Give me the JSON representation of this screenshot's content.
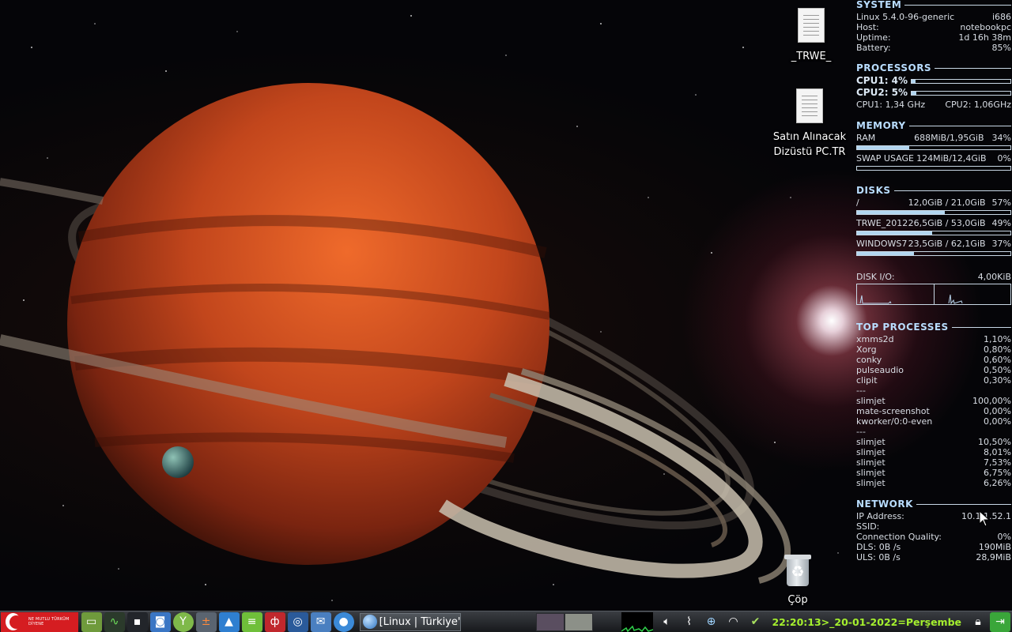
{
  "desktop": {
    "icons": [
      {
        "label": "_TRWE_"
      },
      {
        "label": "Satın Alınacak Dizüstü PC.TR"
      },
      {
        "label": "Çöp"
      }
    ]
  },
  "conky": {
    "system": {
      "header": "SYSTEM",
      "kernel": "Linux 5.4.0-96-generic",
      "arch": "i686",
      "host_label": "Host:",
      "host_value": "notebookpc",
      "uptime_label": "Uptime:",
      "uptime_value": "1d 16h 38m",
      "battery_label": "Battery:",
      "battery_value": "85%"
    },
    "processors": {
      "header": "PROCESSORS",
      "cpu1": "CPU1: 4%",
      "cpu1_level": 0.04,
      "cpu2": "CPU2: 5%",
      "cpu2_level": 0.05,
      "cpu1_freq": "CPU1: 1,34 GHz",
      "cpu2_freq": "CPU2: 1,06GHz"
    },
    "memory": {
      "header": "MEMORY",
      "ram_label": "RAM",
      "ram_value": "688MiB/1,95GiB",
      "ram_pct": "34%",
      "ram_level": 0.34,
      "swap_label": "SWAP USAGE",
      "swap_value": "124MiB/12,4GiB",
      "swap_pct": "0%",
      "swap_level": 0.0
    },
    "disks": {
      "header": "DISKS",
      "items": [
        {
          "name": "/",
          "value": "12,0GiB / 21,0GiB",
          "pct": "57%",
          "level": 0.57
        },
        {
          "name": "TRWE_2012",
          "value": "26,5GiB / 53,0GiB",
          "pct": "49%",
          "level": 0.49
        },
        {
          "name": "WINDOWS7",
          "value": "23,5GiB / 62,1GiB",
          "pct": "37%",
          "level": 0.37
        }
      ],
      "io_label": "DISK I/O:",
      "io_value": "4,00KiB"
    },
    "top": {
      "header": "TOP PROCESSES",
      "group1": [
        {
          "name": "xmms2d",
          "value": "1,10%"
        },
        {
          "name": "Xorg",
          "value": "0,80%"
        },
        {
          "name": "conky",
          "value": "0,60%"
        },
        {
          "name": "pulseaudio",
          "value": "0,50%"
        },
        {
          "name": "clipit",
          "value": "0,30%"
        }
      ],
      "separator": "---",
      "group2": [
        {
          "name": "slimjet",
          "value": "100,00%"
        },
        {
          "name": "mate-screenshot",
          "value": "0,00%"
        },
        {
          "name": "kworker/0:0-even",
          "value": "0,00%"
        }
      ],
      "group3": [
        {
          "name": "slimjet",
          "value": "10,50%"
        },
        {
          "name": "slimjet",
          "value": "8,01%"
        },
        {
          "name": "slimjet",
          "value": "7,53%"
        },
        {
          "name": "slimjet",
          "value": "6,75%"
        },
        {
          "name": "slimjet",
          "value": "6,26%"
        }
      ]
    },
    "network": {
      "header": "NETWORK",
      "ip_label": "IP Address:",
      "ip_value": "10.1.1.52.1",
      "ssid_label": "SSID:",
      "quality_label": "Connection Quality:",
      "quality_value": "0%",
      "dls_label": "DLS: 0B  /s",
      "dls_value": "190MiB",
      "uls_label": "ULS: 0B  /s",
      "uls_value": "28,9MiB"
    }
  },
  "taskbar": {
    "flag_motto": "NE MUTLU TÜRKÜM DİYENE",
    "task_label": "[Linux | Türkiye'nin ...",
    "clock": "22:20:13>_20-01-2022=Perşembe",
    "launcher_icons": [
      "folder-icon",
      "system-monitor-icon",
      "terminal-icon",
      "screenshot-icon",
      "guake-icon",
      "calculator-icon",
      "arch-icon",
      "notes-icon",
      "cherry-icon",
      "disk-icon",
      "mail-icon",
      "browser-icon"
    ],
    "tray_icons": [
      "volume-icon",
      "clipboard-icon",
      "network-manager-icon",
      "wifi-icon",
      "shield-icon",
      "lock-icon",
      "exit-icon"
    ],
    "colors": {
      "clock": "#a5f02e",
      "flag": "#d51d21"
    }
  }
}
